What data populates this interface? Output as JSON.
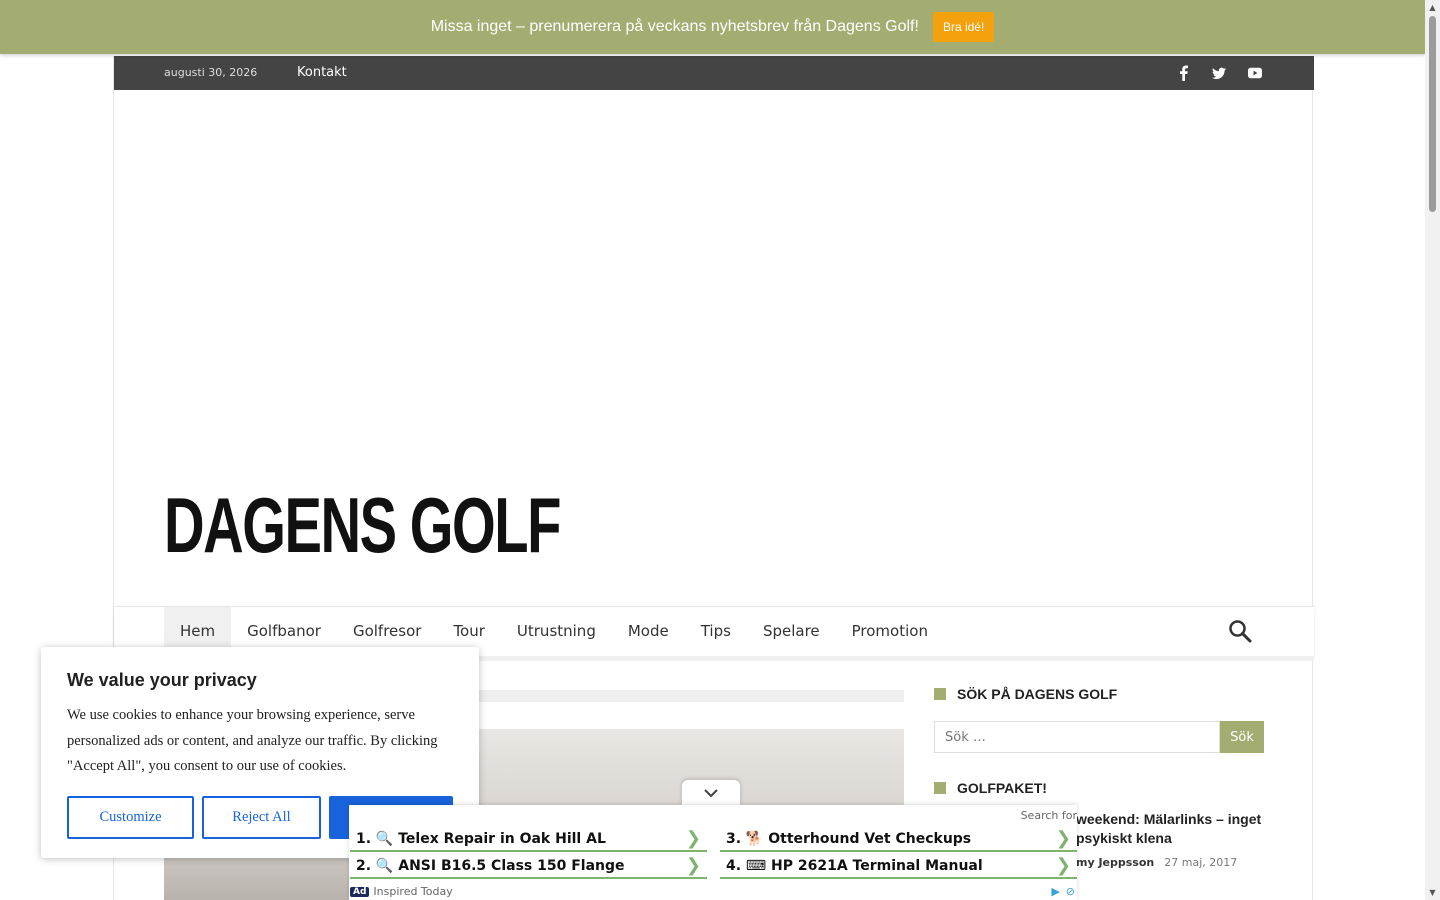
{
  "notice": {
    "text": "Missa inget – prenumerera på veckans nyhetsbrev från Dagens Golf!",
    "button": "Bra idé!"
  },
  "topbar": {
    "date": "augusti 30, 2026",
    "link": "Kontakt",
    "social_icons": [
      "facebook-icon",
      "twitter-icon",
      "youtube-icon"
    ]
  },
  "site": {
    "logo": "DAGENS GOLF"
  },
  "nav": {
    "items": [
      {
        "label": "Hem"
      },
      {
        "label": "Golfbanor"
      },
      {
        "label": "Golfresor"
      },
      {
        "label": "Tour"
      },
      {
        "label": "Utrustning"
      },
      {
        "label": "Mode"
      },
      {
        "label": "Tips"
      },
      {
        "label": "Spelare"
      },
      {
        "label": "Promotion"
      }
    ],
    "active": "Hem"
  },
  "sidebar": {
    "search_title": "SÖK PÅ DAGENS GOLF",
    "search_placeholder": "Sök …",
    "search_button": "Sök",
    "golfpaket_title": "GOLFPAKET!",
    "post": {
      "title": "weekend: Mälarlinks – inget psykiskt klena",
      "author": "my Jeppsson",
      "date": "27 maj, 2017"
    }
  },
  "cookie": {
    "title": "We value your privacy",
    "text": "We use cookies to enhance your browsing experience, serve personalized ads or content, and analyze our traffic. By clicking \"Accept All\", you consent to our use of cookies.",
    "customize": "Customize",
    "reject": "Reject All",
    "accept": ""
  },
  "ad": {
    "search_for": "Search for",
    "items": [
      {
        "label": "1. 🔍 Telex Repair in Oak Hill AL"
      },
      {
        "label": "2. 🔍 ANSI B16.5 Class 150 Flange"
      },
      {
        "label": "3. 🐕 Otterhound Vet Checkups"
      },
      {
        "label": "4. ⌨ HP 2621A Terminal Manual"
      }
    ],
    "badge": "Ad",
    "source": "Inspired Today"
  },
  "colors": {
    "accent": "#a3ad72",
    "notice_button": "#f3a10c",
    "cookie_blue": "#1863dc",
    "topbar": "#444444"
  }
}
